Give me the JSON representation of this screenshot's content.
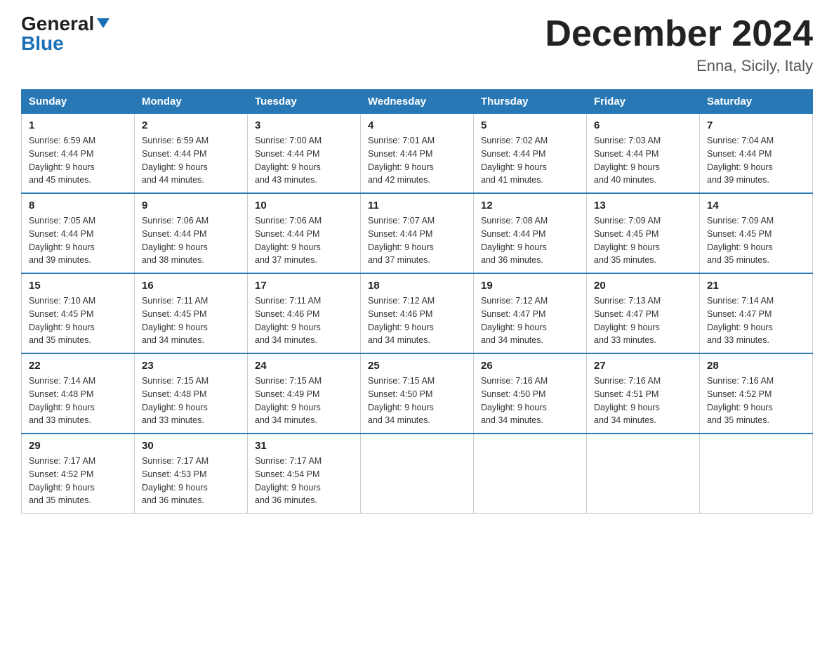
{
  "logo": {
    "general": "General",
    "blue": "Blue"
  },
  "title": "December 2024",
  "location": "Enna, Sicily, Italy",
  "days_of_week": [
    "Sunday",
    "Monday",
    "Tuesday",
    "Wednesday",
    "Thursday",
    "Friday",
    "Saturday"
  ],
  "weeks": [
    [
      {
        "num": "1",
        "sunrise": "6:59 AM",
        "sunset": "4:44 PM",
        "daylight": "9 hours and 45 minutes."
      },
      {
        "num": "2",
        "sunrise": "6:59 AM",
        "sunset": "4:44 PM",
        "daylight": "9 hours and 44 minutes."
      },
      {
        "num": "3",
        "sunrise": "7:00 AM",
        "sunset": "4:44 PM",
        "daylight": "9 hours and 43 minutes."
      },
      {
        "num": "4",
        "sunrise": "7:01 AM",
        "sunset": "4:44 PM",
        "daylight": "9 hours and 42 minutes."
      },
      {
        "num": "5",
        "sunrise": "7:02 AM",
        "sunset": "4:44 PM",
        "daylight": "9 hours and 41 minutes."
      },
      {
        "num": "6",
        "sunrise": "7:03 AM",
        "sunset": "4:44 PM",
        "daylight": "9 hours and 40 minutes."
      },
      {
        "num": "7",
        "sunrise": "7:04 AM",
        "sunset": "4:44 PM",
        "daylight": "9 hours and 39 minutes."
      }
    ],
    [
      {
        "num": "8",
        "sunrise": "7:05 AM",
        "sunset": "4:44 PM",
        "daylight": "9 hours and 39 minutes."
      },
      {
        "num": "9",
        "sunrise": "7:06 AM",
        "sunset": "4:44 PM",
        "daylight": "9 hours and 38 minutes."
      },
      {
        "num": "10",
        "sunrise": "7:06 AM",
        "sunset": "4:44 PM",
        "daylight": "9 hours and 37 minutes."
      },
      {
        "num": "11",
        "sunrise": "7:07 AM",
        "sunset": "4:44 PM",
        "daylight": "9 hours and 37 minutes."
      },
      {
        "num": "12",
        "sunrise": "7:08 AM",
        "sunset": "4:44 PM",
        "daylight": "9 hours and 36 minutes."
      },
      {
        "num": "13",
        "sunrise": "7:09 AM",
        "sunset": "4:45 PM",
        "daylight": "9 hours and 35 minutes."
      },
      {
        "num": "14",
        "sunrise": "7:09 AM",
        "sunset": "4:45 PM",
        "daylight": "9 hours and 35 minutes."
      }
    ],
    [
      {
        "num": "15",
        "sunrise": "7:10 AM",
        "sunset": "4:45 PM",
        "daylight": "9 hours and 35 minutes."
      },
      {
        "num": "16",
        "sunrise": "7:11 AM",
        "sunset": "4:45 PM",
        "daylight": "9 hours and 34 minutes."
      },
      {
        "num": "17",
        "sunrise": "7:11 AM",
        "sunset": "4:46 PM",
        "daylight": "9 hours and 34 minutes."
      },
      {
        "num": "18",
        "sunrise": "7:12 AM",
        "sunset": "4:46 PM",
        "daylight": "9 hours and 34 minutes."
      },
      {
        "num": "19",
        "sunrise": "7:12 AM",
        "sunset": "4:47 PM",
        "daylight": "9 hours and 34 minutes."
      },
      {
        "num": "20",
        "sunrise": "7:13 AM",
        "sunset": "4:47 PM",
        "daylight": "9 hours and 33 minutes."
      },
      {
        "num": "21",
        "sunrise": "7:14 AM",
        "sunset": "4:47 PM",
        "daylight": "9 hours and 33 minutes."
      }
    ],
    [
      {
        "num": "22",
        "sunrise": "7:14 AM",
        "sunset": "4:48 PM",
        "daylight": "9 hours and 33 minutes."
      },
      {
        "num": "23",
        "sunrise": "7:15 AM",
        "sunset": "4:48 PM",
        "daylight": "9 hours and 33 minutes."
      },
      {
        "num": "24",
        "sunrise": "7:15 AM",
        "sunset": "4:49 PM",
        "daylight": "9 hours and 34 minutes."
      },
      {
        "num": "25",
        "sunrise": "7:15 AM",
        "sunset": "4:50 PM",
        "daylight": "9 hours and 34 minutes."
      },
      {
        "num": "26",
        "sunrise": "7:16 AM",
        "sunset": "4:50 PM",
        "daylight": "9 hours and 34 minutes."
      },
      {
        "num": "27",
        "sunrise": "7:16 AM",
        "sunset": "4:51 PM",
        "daylight": "9 hours and 34 minutes."
      },
      {
        "num": "28",
        "sunrise": "7:16 AM",
        "sunset": "4:52 PM",
        "daylight": "9 hours and 35 minutes."
      }
    ],
    [
      {
        "num": "29",
        "sunrise": "7:17 AM",
        "sunset": "4:52 PM",
        "daylight": "9 hours and 35 minutes."
      },
      {
        "num": "30",
        "sunrise": "7:17 AM",
        "sunset": "4:53 PM",
        "daylight": "9 hours and 36 minutes."
      },
      {
        "num": "31",
        "sunrise": "7:17 AM",
        "sunset": "4:54 PM",
        "daylight": "9 hours and 36 minutes."
      },
      null,
      null,
      null,
      null
    ]
  ],
  "labels": {
    "sunrise": "Sunrise:",
    "sunset": "Sunset:",
    "daylight": "Daylight:"
  }
}
